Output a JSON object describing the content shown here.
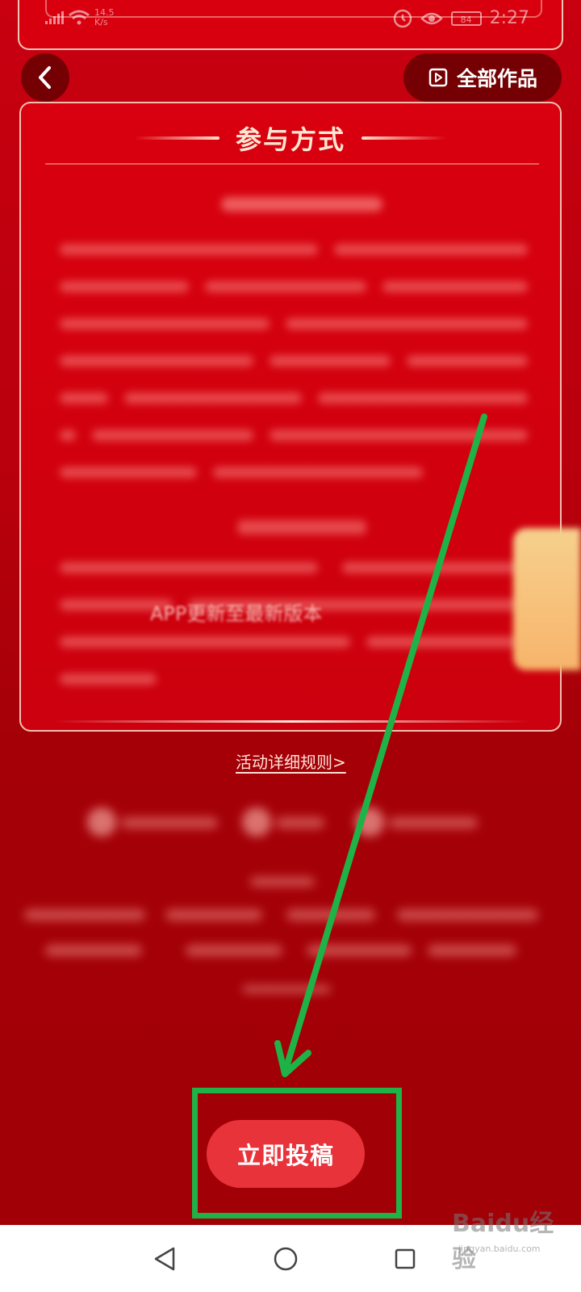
{
  "status_bar": {
    "net_speed_value": "14.5",
    "net_speed_unit": "K/s",
    "battery": "84",
    "time": "2:27"
  },
  "header": {
    "all_works_label": "全部作品"
  },
  "rules_card": {
    "title": "参与方式",
    "visible_fragment": "APP更新至最新版本"
  },
  "rules_link_label": "活动详细规则>",
  "submit_button_label": "立即投稿",
  "watermark": {
    "logo": "Baidu经验",
    "url": "jingyan.baidu.com"
  },
  "colors": {
    "primary_red": "#d9000f",
    "button_red": "#e9333b",
    "annotation_green": "#1fb347"
  }
}
